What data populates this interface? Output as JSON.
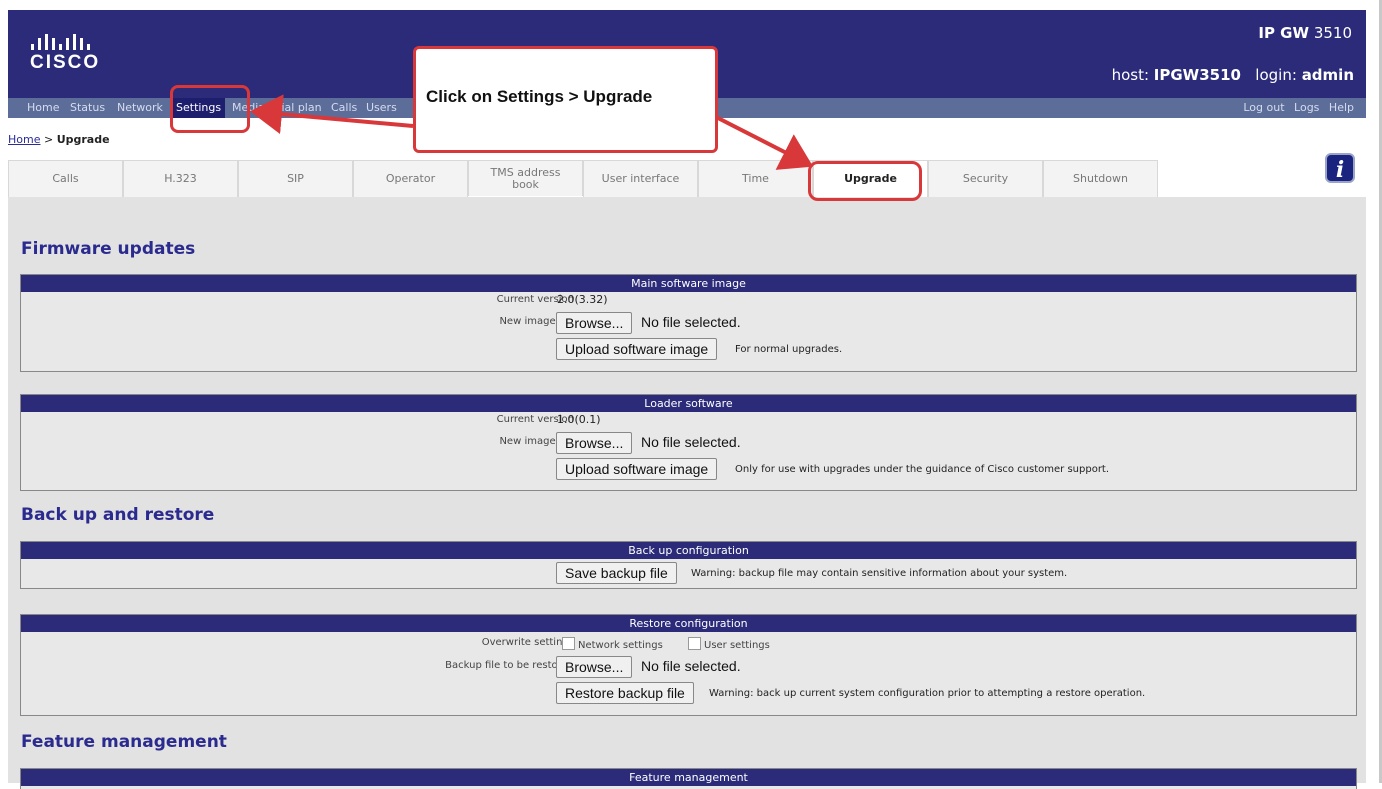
{
  "header": {
    "product_bold": "IP GW",
    "product_num": "3510",
    "host_label": "host:",
    "host_value": "IPGW3510",
    "login_label": "login:",
    "login_value": "admin",
    "logo_text": "CISCO"
  },
  "nav": {
    "items": [
      "Home",
      "Status",
      "Network",
      "Settings",
      "Media",
      "Dial plan",
      "Calls",
      "Users"
    ],
    "active": "Settings",
    "right": [
      "Log out",
      "Logs",
      "Help"
    ]
  },
  "breadcrumb": {
    "home": "Home",
    "sep": " > ",
    "current": "Upgrade"
  },
  "tabs": [
    "Calls",
    "H.323",
    "SIP",
    "Operator",
    "TMS address book",
    "User interface",
    "Time",
    "Upgrade",
    "Security",
    "Shutdown"
  ],
  "active_tab": "Upgrade",
  "info_icon": "i",
  "sections": {
    "firmware": "Firmware updates",
    "backup": "Back up and restore",
    "feature": "Feature management"
  },
  "main_image": {
    "title": "Main software image",
    "current_label": "Current version",
    "current_value": "2.0(3.32)",
    "new_label": "New image file",
    "browse": "Browse...",
    "nofile": "No file selected.",
    "upload": "Upload software image",
    "note": "For normal upgrades."
  },
  "loader": {
    "title": "Loader software",
    "current_label": "Current version",
    "current_value": "1.0(0.1)",
    "new_label": "New image file",
    "browse": "Browse...",
    "nofile": "No file selected.",
    "upload": "Upload software image",
    "note": "Only for use with upgrades under the guidance of Cisco customer support."
  },
  "backup_cfg": {
    "title": "Back up configuration",
    "save": "Save backup file",
    "note": "Warning: backup file may contain sensitive information about your system."
  },
  "restore_cfg": {
    "title": "Restore configuration",
    "overwrite_label": "Overwrite settings",
    "network": "Network settings",
    "user": "User settings",
    "file_label": "Backup file to be restored",
    "browse": "Browse...",
    "nofile": "No file selected.",
    "restore": "Restore backup file",
    "note": "Warning: back up current system configuration prior to attempting a restore operation."
  },
  "feature_panel": {
    "title": "Feature management"
  },
  "annotation": {
    "text": "Click on Settings > Upgrade"
  },
  "colors": {
    "header": "#2b2b7a",
    "navbar": "#5d6d9a",
    "accent": "#d8383a",
    "section_title": "#2b2b8f"
  }
}
